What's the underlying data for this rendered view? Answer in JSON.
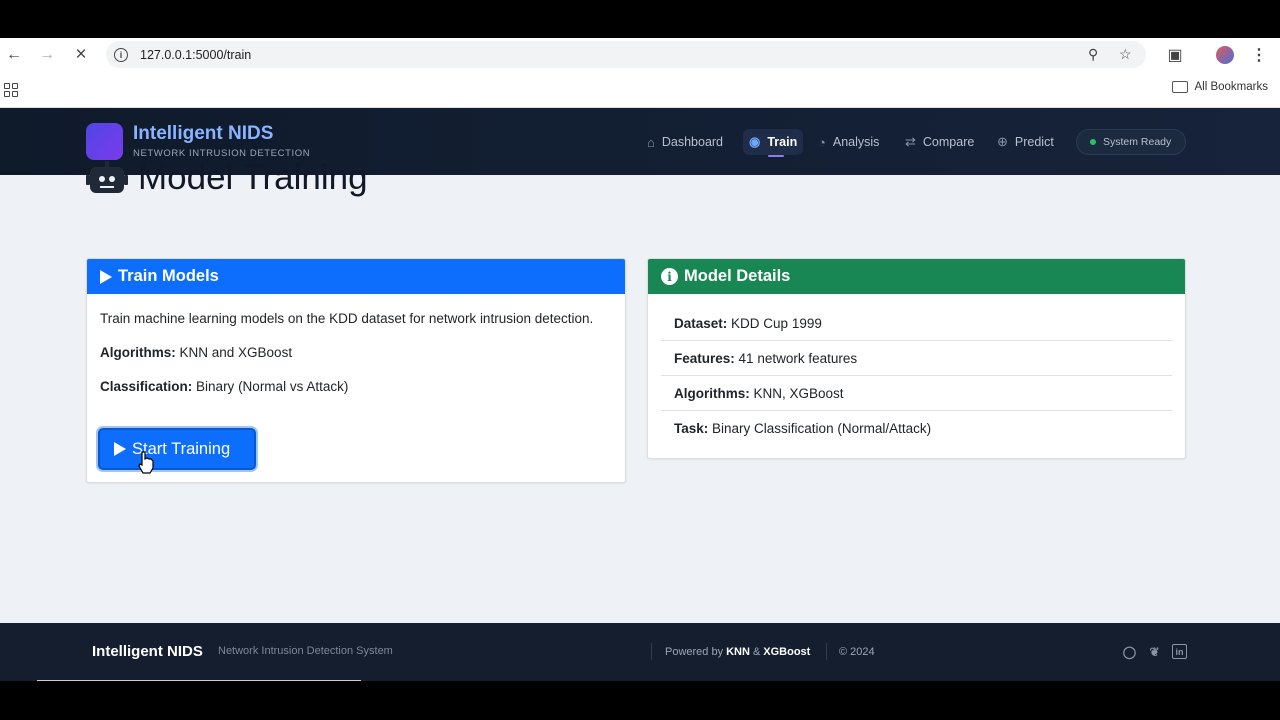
{
  "browser": {
    "url": "127.0.0.1:5000/train",
    "bookmarks_label": "All Bookmarks"
  },
  "app": {
    "brand_title": "Intelligent NIDS",
    "brand_subtitle": "NETWORK INTRUSION DETECTION",
    "nav": [
      {
        "label": "Dashboard",
        "icon": "home-icon"
      },
      {
        "label": "Train",
        "icon": "brain-icon",
        "active": true
      },
      {
        "label": "Analysis",
        "icon": "pie-chart-icon"
      },
      {
        "label": "Compare",
        "icon": "arrows-exchange-icon"
      },
      {
        "label": "Predict",
        "icon": "crosshair-icon"
      }
    ],
    "status": "System Ready",
    "colors": {
      "primary": "#0d6efd",
      "success": "#198754",
      "navbar": "#0f1a2b",
      "status_dot": "#22c55e"
    }
  },
  "page": {
    "title": "Model Training"
  },
  "train_card": {
    "header": "Train Models",
    "description": "Train machine learning models on the KDD dataset for network intrusion detection.",
    "algorithms_label": "Algorithms:",
    "algorithms_value": "KNN and XGBoost",
    "classification_label": "Classification:",
    "classification_value": "Binary (Normal vs Attack)",
    "button_label": "Start Training"
  },
  "details_card": {
    "header": "Model Details",
    "rows": [
      {
        "label": "Dataset:",
        "value": "KDD Cup 1999"
      },
      {
        "label": "Features:",
        "value": "41 network features"
      },
      {
        "label": "Algorithms:",
        "value": "KNN, XGBoost"
      },
      {
        "label": "Task:",
        "value": "Binary Classification (Normal/Attack)"
      }
    ]
  },
  "footer": {
    "brand": "Intelligent NIDS",
    "subtitle": "Network Intrusion Detection System",
    "powered_prefix": "Powered by",
    "powered_a": "KNN",
    "powered_amp": "&",
    "powered_b": "XGBoost",
    "copyright": "© 2024"
  }
}
